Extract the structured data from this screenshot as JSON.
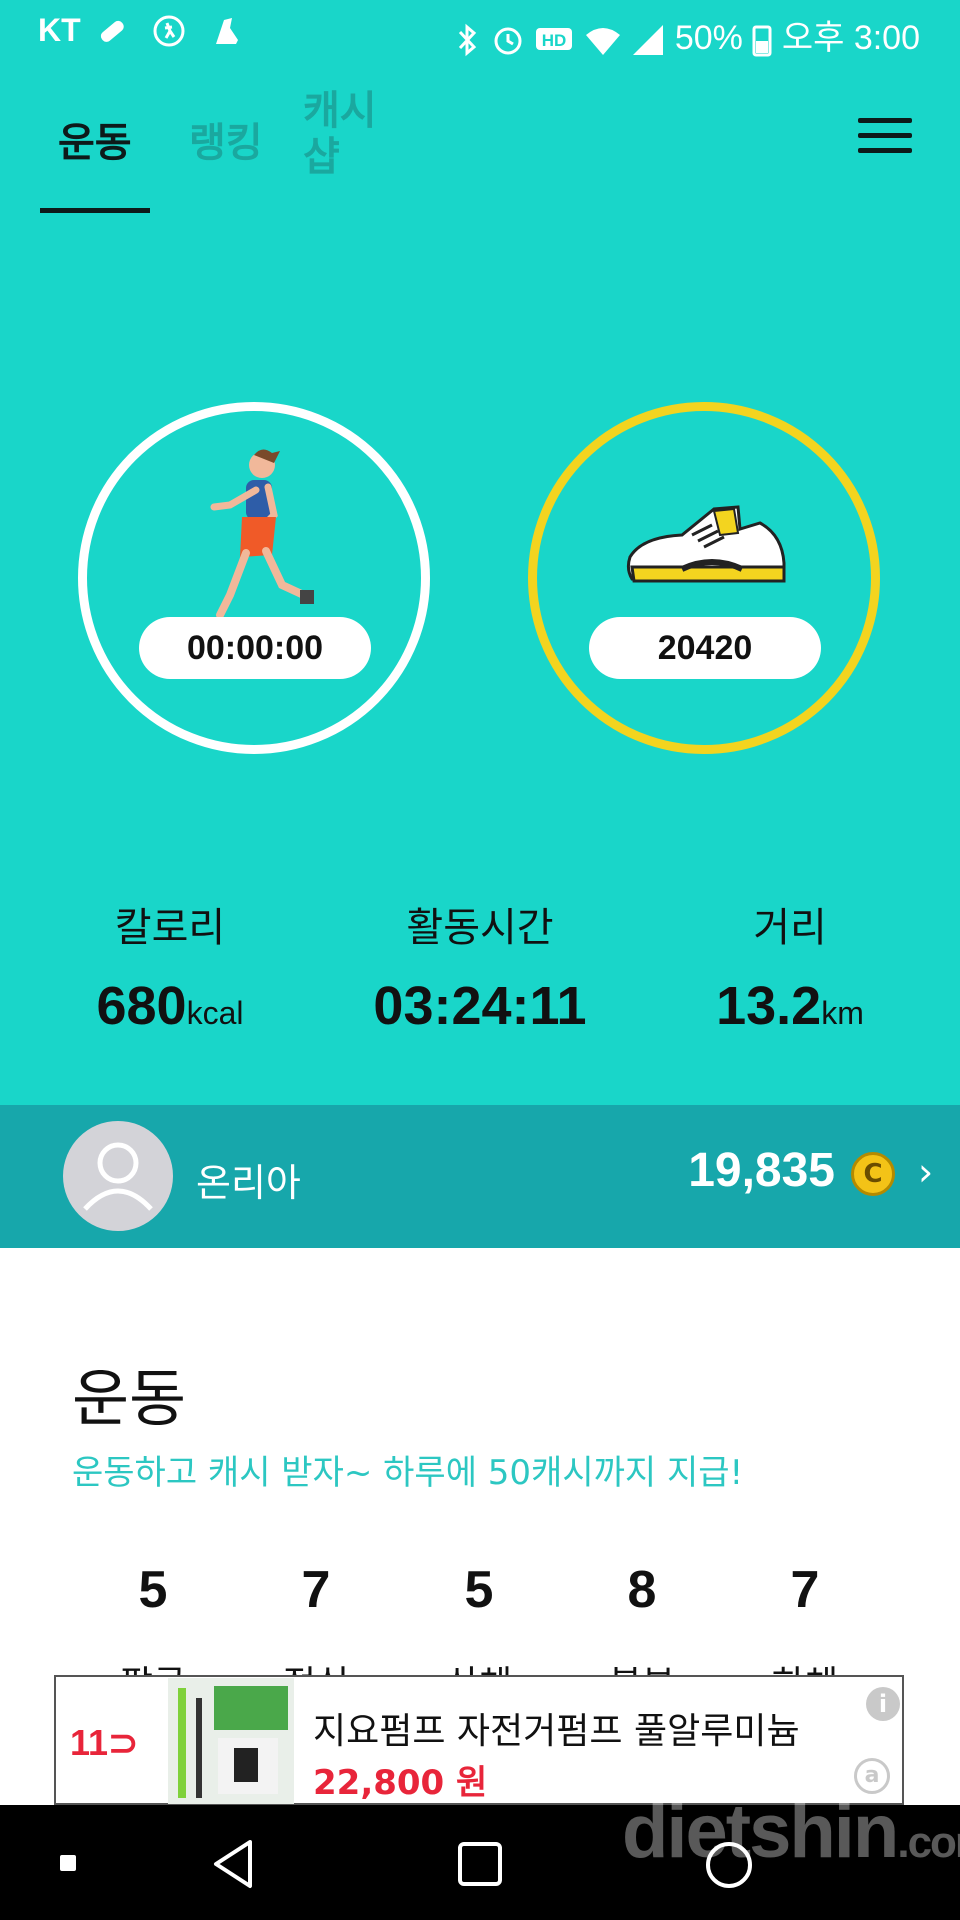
{
  "status_bar": {
    "carrier": "KT",
    "battery": "50%",
    "time": "오후 3:00",
    "icons": [
      "bandage-icon",
      "walk-icon",
      "shoe-icon",
      "bluetooth-icon",
      "alarm-icon",
      "hd-icon",
      "wifi-icon",
      "signal-icon",
      "battery-icon"
    ]
  },
  "tabs": [
    {
      "label": "운동",
      "active": true
    },
    {
      "label": "랭킹",
      "active": false
    },
    {
      "label": "캐시샵",
      "line1": "캐시",
      "line2": "샵",
      "active": false
    }
  ],
  "tracker": {
    "timer": "00:00:00",
    "steps": "20420"
  },
  "stats": {
    "calories_label": "칼로리",
    "calories_value": "680",
    "calories_unit": "kcal",
    "active_time_label": "활동시간",
    "active_time_value": "03:24:11",
    "distance_label": "거리",
    "distance_value": "13.2",
    "distance_unit": "km"
  },
  "user": {
    "name": "온리아",
    "points": "19,835",
    "coin_symbol": "C"
  },
  "section": {
    "title": "운동",
    "subtitle": "운동하고 캐시 받자~ 하루에 50캐시까지 지급!",
    "counts": [
      {
        "value": "5",
        "label": "팔굽"
      },
      {
        "value": "7",
        "label": "점심"
      },
      {
        "value": "5",
        "label": "상체"
      },
      {
        "value": "8",
        "label": "복부"
      },
      {
        "value": "7",
        "label": "하체"
      }
    ]
  },
  "ad": {
    "logo": "11",
    "title": "지요펌프 자전거펌프 풀알루미늄",
    "price": "22,800 원",
    "info_icon": "i",
    "choice_icon": "a"
  },
  "watermark": {
    "main": "dietshin",
    "suffix": ".com"
  },
  "colors": {
    "teal": "#19d6c9",
    "user_bar": "#17a7ab",
    "steps_ring": "#f3d41f",
    "subtitle": "#2cc7c2",
    "ad_price": "#e8253a"
  }
}
